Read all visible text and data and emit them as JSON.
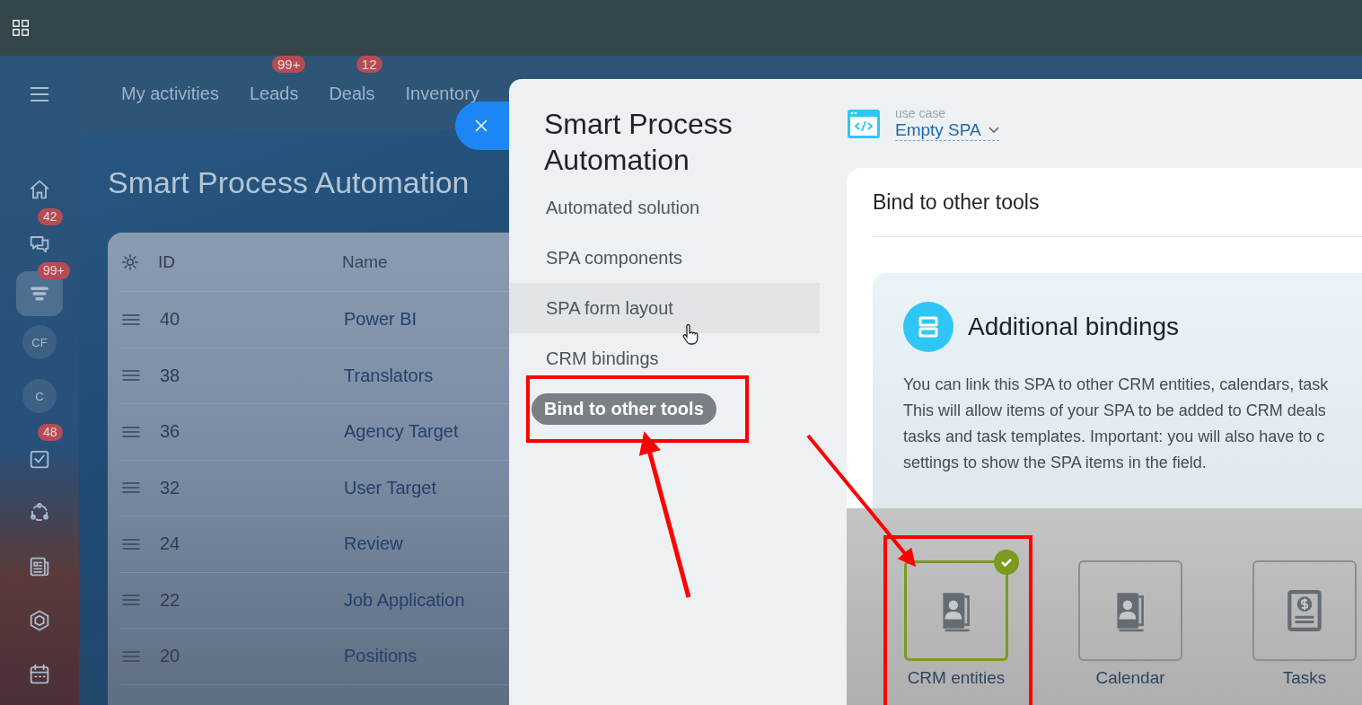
{
  "sidebar": {
    "items": [
      {
        "kind": "menu",
        "selected": false
      },
      {
        "kind": "home",
        "selected": false
      },
      {
        "kind": "chat",
        "badge": "42",
        "selected": false
      },
      {
        "kind": "funnel",
        "badge": "99+",
        "selected": true
      },
      {
        "kind": "avatar",
        "label": "CF",
        "selected": false
      },
      {
        "kind": "avatar",
        "label": "C",
        "selected": false
      },
      {
        "kind": "tasks",
        "badge": "48",
        "selected": false
      },
      {
        "kind": "flow",
        "selected": false
      },
      {
        "kind": "news",
        "selected": false
      },
      {
        "kind": "hexagon",
        "selected": false
      },
      {
        "kind": "calendar",
        "selected": false
      }
    ]
  },
  "nav": {
    "items": [
      {
        "label": "My activities"
      },
      {
        "label": "Leads",
        "badge": "99+"
      },
      {
        "label": "Deals",
        "badge": "12"
      },
      {
        "label": "Inventory"
      }
    ]
  },
  "page": {
    "title": "Smart Process Automation",
    "table": {
      "columns": [
        "ID",
        "Name"
      ],
      "rows": [
        {
          "id": "40",
          "name": "Power BI"
        },
        {
          "id": "38",
          "name": "Translators"
        },
        {
          "id": "36",
          "name": "Agency Target"
        },
        {
          "id": "32",
          "name": "User Target"
        },
        {
          "id": "24",
          "name": "Review"
        },
        {
          "id": "22",
          "name": "Job Application"
        },
        {
          "id": "20",
          "name": "Positions"
        }
      ]
    }
  },
  "slider": {
    "title": "Smart Process Automation",
    "menu": [
      {
        "label": "Automated solution",
        "selected": false,
        "hovered": false
      },
      {
        "label": "SPA components",
        "selected": false,
        "hovered": false
      },
      {
        "label": "SPA form layout",
        "selected": false,
        "hovered": true
      },
      {
        "label": "CRM bindings",
        "selected": false,
        "hovered": false
      },
      {
        "label": "Bind to other tools",
        "selected": true,
        "hovered": false
      }
    ],
    "use_case": {
      "caption": "use case",
      "value": "Empty SPA"
    },
    "section_title": "Bind to other tools",
    "bindings": {
      "title": "Additional bindings",
      "description_lines": [
        "You can link this SPA to other CRM entities, calendars, task",
        "This will allow items of your SPA to be added to CRM deals",
        "tasks and task templates. Important: you will also have to c",
        "settings to show the SPA items in the field."
      ],
      "tiles": [
        {
          "kind": "contact-book",
          "label": "CRM entities",
          "checked": true
        },
        {
          "kind": "contact-book",
          "label": "Calendar",
          "checked": false
        },
        {
          "kind": "invoice",
          "label": "Tasks",
          "checked": false
        }
      ]
    }
  }
}
